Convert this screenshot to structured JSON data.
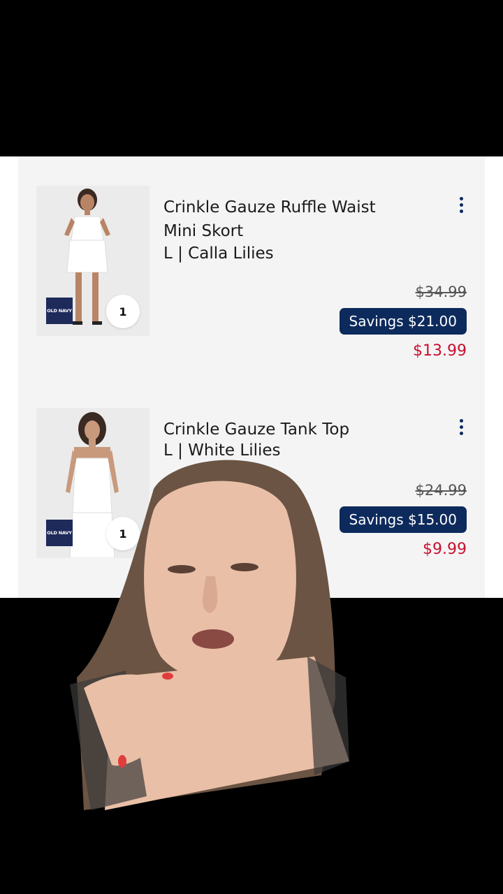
{
  "cart": {
    "items": [
      {
        "title_line1": "Crinkle Gauze Ruffle Waist",
        "title_line2": "Mini Skort",
        "variant": "L  |  Calla Lilies",
        "original_price": "$34.99",
        "savings": "Savings $21.00",
        "sale_price": "$13.99",
        "quantity": "1",
        "brand": "OLD NAVY"
      },
      {
        "title_line1": "Crinkle Gauze Tank Top",
        "title_line2": "",
        "variant": "L  |  White Lilies",
        "original_price": "$24.99",
        "savings": "Savings $15.00",
        "sale_price": "$9.99",
        "quantity": "1",
        "brand": "OLD NAVY"
      }
    ]
  },
  "colors": {
    "accent_navy": "#0d2a5c",
    "sale_red": "#c8102e",
    "panel_bg": "#f4f4f5"
  }
}
